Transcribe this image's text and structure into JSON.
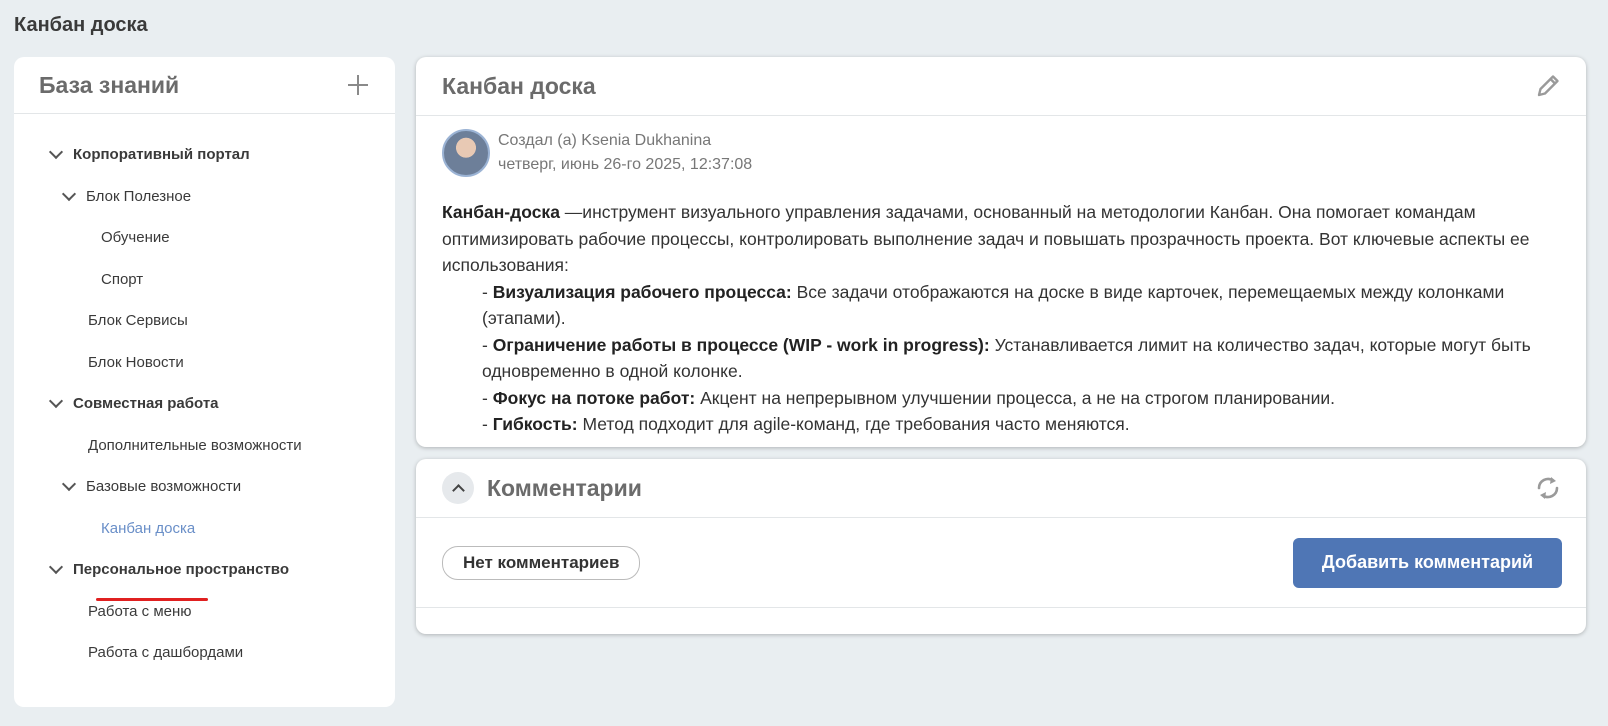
{
  "page": {
    "title": "Канбан доска"
  },
  "sidebar": {
    "title": "База знаний",
    "add_icon": "plus-icon",
    "items": [
      {
        "label": "Корпоративный портал",
        "level": 0,
        "expanded": true,
        "bold": true
      },
      {
        "label": "Блок Полезное",
        "level": 1,
        "expanded": true
      },
      {
        "label": "Обучение",
        "level": 2
      },
      {
        "label": "Спорт",
        "level": 2
      },
      {
        "label": "Блок Сервисы",
        "level": 1
      },
      {
        "label": "Блок Новости",
        "level": 1
      },
      {
        "label": "Совместная работа",
        "level": 0,
        "expanded": true,
        "bold": true
      },
      {
        "label": "Дополнительные возможности",
        "level": 1
      },
      {
        "label": "Базовые возможности",
        "level": 1,
        "expanded": true
      },
      {
        "label": "Канбан доска",
        "level": 2,
        "active": true
      },
      {
        "label": "Персональное пространство",
        "level": 0,
        "expanded": true,
        "bold": true
      },
      {
        "label": "Работа с меню",
        "level": 1
      },
      {
        "label": "Работа с дашбордами",
        "level": 1
      }
    ]
  },
  "article": {
    "title": "Канбан доска",
    "edit_icon": "pencil-icon",
    "author_line": "Создал (а) Ksenia Dukhanina",
    "date_line": "четверг, июнь 26-го 2025, 12:37:08",
    "intro_bold": "Канбан-доска",
    "intro_text": " —инструмент визуального управления задачами, основанный на методологии Канбан. Она помогает командам оптимизировать рабочие процессы, контролировать выполнение задач и повышать прозрачность проекта. Вот ключевые аспекты ее использования:",
    "points": [
      {
        "prefix": "- ",
        "bold": "Визуализация рабочего процесса:",
        "text": " Все задачи отображаются на доске в виде карточек, перемещаемых между колонками (этапами)."
      },
      {
        "prefix": "- ",
        "bold": "Ограничение работы в процессе (WIP - work in progress):",
        "text": " Устанавливается лимит на количество задач, которые могут быть одновременно в одной колонке."
      },
      {
        "prefix": "- ",
        "bold": "Фокус на потоке работ:",
        "text": " Акцент на непрерывном улучшении процесса, а не на строгом планировании."
      },
      {
        "prefix": "- ",
        "bold": "Гибкость:",
        "text": " Метод подходит для agile-команд, где требования часто меняются."
      }
    ]
  },
  "comments": {
    "title": "Комментарии",
    "refresh_icon": "refresh-icon",
    "collapse_icon": "chevron-up-icon",
    "empty_label": "Нет комментариев",
    "add_button_label": "Добавить комментарий"
  },
  "colors": {
    "accent": "#4f76b5",
    "active_link": "#6a8fc8",
    "highlight": "#e02020",
    "background": "#e9eef1"
  }
}
